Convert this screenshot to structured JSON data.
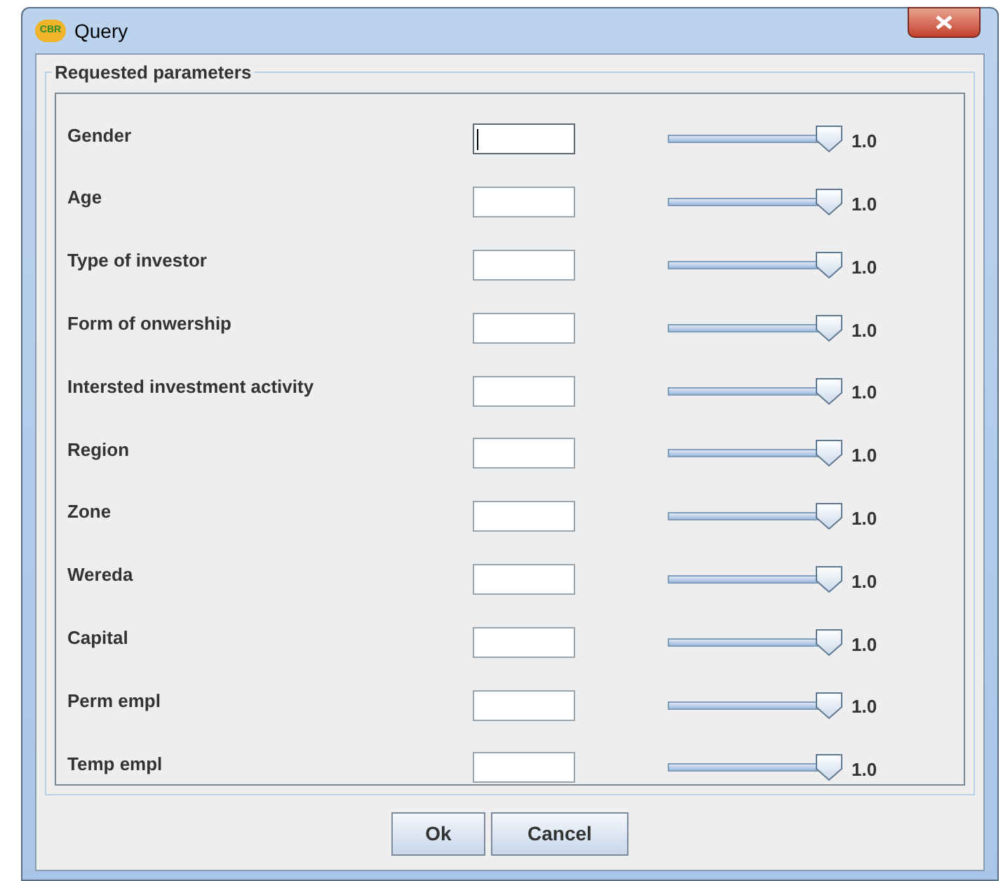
{
  "window": {
    "title": "Query",
    "icon_text": "CBR"
  },
  "group": {
    "title": "Requested parameters"
  },
  "parameters": [
    {
      "label": "Gender",
      "focused": true,
      "level": 1.0,
      "reading": "1.0"
    },
    {
      "label": "Age",
      "focused": false,
      "level": 1.0,
      "reading": "1.0"
    },
    {
      "label": "Type of investor",
      "focused": false,
      "level": 1.0,
      "reading": "1.0"
    },
    {
      "label": "Form of onwership",
      "focused": false,
      "level": 1.0,
      "reading": "1.0"
    },
    {
      "label": "Intersted investment activity",
      "focused": false,
      "level": 1.0,
      "reading": "1.0"
    },
    {
      "label": "Region",
      "focused": false,
      "level": 1.0,
      "reading": "1.0"
    },
    {
      "label": "Zone",
      "focused": false,
      "level": 1.0,
      "reading": "1.0"
    },
    {
      "label": "Wereda",
      "focused": false,
      "level": 1.0,
      "reading": "1.0"
    },
    {
      "label": "Capital",
      "focused": false,
      "level": 1.0,
      "reading": "1.0"
    },
    {
      "label": "Perm empl",
      "focused": false,
      "level": 1.0,
      "reading": "1.0"
    },
    {
      "label": "Temp empl",
      "focused": false,
      "level": 1.0,
      "reading": "1.0"
    }
  ],
  "buttons": [
    "Ok",
    "Cancel"
  ]
}
